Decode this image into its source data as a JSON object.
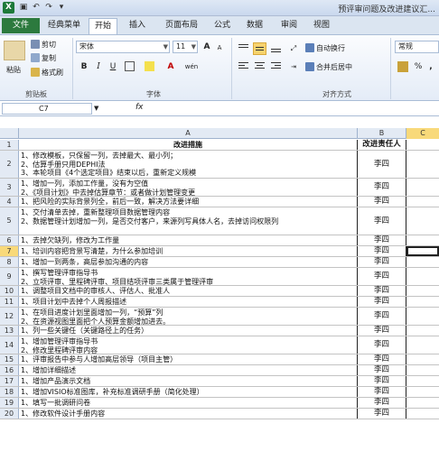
{
  "titlebar": {
    "logo": "X",
    "doc_title": "预评审问题及改进建议汇..."
  },
  "tabs": {
    "file": "文件",
    "items": [
      "经典菜单",
      "开始",
      "插入",
      "页面布局",
      "公式",
      "数据",
      "审阅",
      "视图"
    ],
    "active": "开始"
  },
  "ribbon": {
    "clipboard": {
      "paste": "粘贴",
      "cut": "剪切",
      "copy": "复制",
      "format_painter": "格式刷",
      "label": "剪贴板"
    },
    "font": {
      "name": "宋体",
      "size": "11",
      "bold": "B",
      "italic": "I",
      "underline": "U",
      "grow": "A",
      "shrink": "A",
      "phonetic": "wén",
      "font_color": "A",
      "label": "字体"
    },
    "alignment": {
      "wrap": "自动换行",
      "merge": "合并后居中",
      "label": "对齐方式"
    },
    "number": {
      "format": "常规",
      "currency": "%",
      "comma": ",",
      "label": ""
    }
  },
  "formula_bar": {
    "cell_ref": "C7",
    "fx": "fx",
    "value": ""
  },
  "columns": [
    "A",
    "B",
    "C"
  ],
  "rows": [
    {
      "n": "1",
      "a": "改进措施",
      "b": "改进责任人",
      "header": true
    },
    {
      "n": "2",
      "a": "1、修改模板，只保留一列，去掉最大、最小列；\n2、估算手册只用DEPHI法\n3、本轮项目《4个选定项目》结束以后，重新定义规模",
      "b": "李四"
    },
    {
      "n": "3",
      "a": "1、增加一列，添加工作量，没有为空值\n2、《项目计划》中去掉估算章节：或者做计划管理变更",
      "b": "李四"
    },
    {
      "n": "4",
      "a": "1、把风险的实际背景列全，前后一致，解决方法要详细",
      "b": "李四"
    },
    {
      "n": "5",
      "a": "1、交付清单去掉，重新整理项目数据管理内容\n2、数据管理计划增加一列，是否交付客户，来源列写具体人名，去掉访问权限列",
      "b": "李四"
    },
    {
      "n": "6",
      "a": "1、去掉欠缺列，修改为工作量",
      "b": "李四"
    },
    {
      "n": "7",
      "a": "1、培训内容把背景写清楚，为什么参加培训",
      "b": "李四"
    },
    {
      "n": "8",
      "a": "1、增加一到两条，高层参加沟通的内容",
      "b": "李四"
    },
    {
      "n": "9",
      "a": "1、撰写管理评审指导书\n2、立项评审、里程碑评审、项目结项评审三类属于管理评审",
      "b": "李四"
    },
    {
      "n": "10",
      "a": "1、调整项目文档中的审核人、评估人、批准人",
      "b": "李四"
    },
    {
      "n": "11",
      "a": "1、项目计划中去掉个人周报描述",
      "b": "李四"
    },
    {
      "n": "12",
      "a": "1、在项目进度计划里面增加一列，“预算”列\n2、在资源视图里面把个人预算金额增加进去。",
      "b": "李四"
    },
    {
      "n": "13",
      "a": "1、列一些关键任（关键路径上的任务）",
      "b": "李四"
    },
    {
      "n": "14",
      "a": "1、增加管理评审指导书\n2、修改里程碑评审内容",
      "b": "李四"
    },
    {
      "n": "15",
      "a": "1、评审报告中参与人增加高层领导（项目主管）",
      "b": "李四"
    },
    {
      "n": "16",
      "a": "1、增加详细描述",
      "b": "李四"
    },
    {
      "n": "17",
      "a": "1、增加产品演示文档",
      "b": "李四"
    },
    {
      "n": "18",
      "a": "1、增加VISIO标准图库，补充标准调研手册（简化处理）",
      "b": "李四"
    },
    {
      "n": "19",
      "a": "1、填写一批调研问卷",
      "b": "李四"
    },
    {
      "n": "20",
      "a": "1、修改软件设计手册内容",
      "b": "李四"
    }
  ],
  "selected_row": "7",
  "selected_col": "C"
}
